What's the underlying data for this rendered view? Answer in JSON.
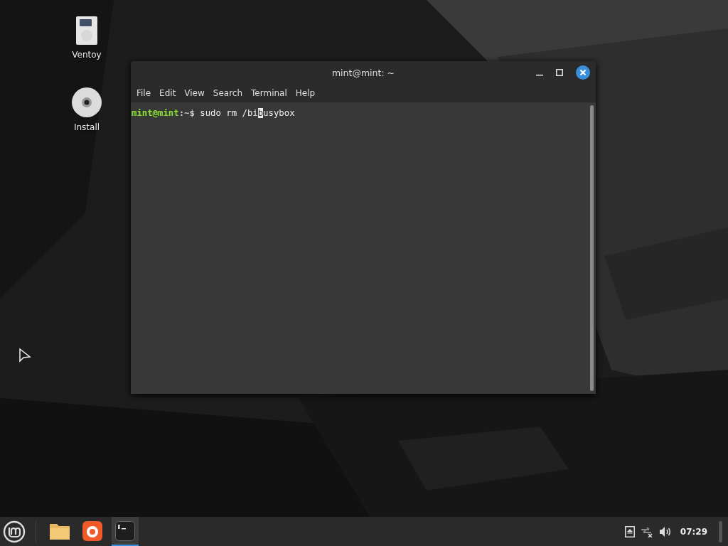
{
  "desktop_icons": [
    {
      "kind": "drive",
      "label": "Ventoy"
    },
    {
      "kind": "disc",
      "label": "Install"
    }
  ],
  "window": {
    "title": "mint@mint: ~",
    "menu": [
      "File",
      "Edit",
      "View",
      "Search",
      "Terminal",
      "Help"
    ],
    "terminal": {
      "user_host": "mint@mint",
      "path_prompt": ":~$",
      "command_before_cursor": "sudo rm /bi",
      "cursor_char": "b",
      "command_after_cursor": "usybox"
    }
  },
  "taskbar": {
    "apps": [
      {
        "kind": "folder",
        "selected": false
      },
      {
        "kind": "browser",
        "selected": false
      },
      {
        "kind": "terminal",
        "selected": true
      }
    ],
    "clock": "07:29"
  }
}
